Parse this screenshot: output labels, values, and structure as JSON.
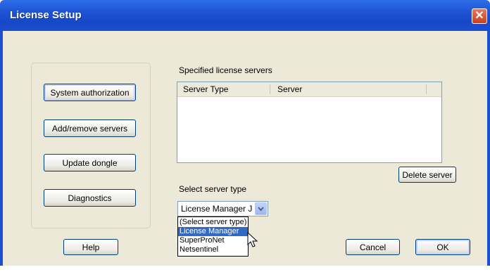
{
  "window": {
    "title": "License Setup",
    "close_glyph": "✕"
  },
  "left_buttons": [
    {
      "label": "System authorization"
    },
    {
      "label": "Add/remove servers"
    },
    {
      "label": "Update dongle"
    },
    {
      "label": "Diagnostics"
    }
  ],
  "servers": {
    "label": "Specified license servers",
    "columns": [
      "Server Type",
      "Server"
    ],
    "rows": []
  },
  "delete_label": "Delete server",
  "server_type": {
    "label": "Select server type",
    "selected_display": "License Manager  J",
    "options": [
      "(Select server type)",
      "License Manager",
      "SuperProNet",
      "Netsentinel"
    ],
    "highlighted_index": 1
  },
  "footer": {
    "help": "Help",
    "cancel": "Cancel",
    "ok": "OK"
  },
  "colors": {
    "title_bar": "#1f55d6",
    "selection": "#316ac5",
    "dialog_bg": "#ece9d8"
  }
}
